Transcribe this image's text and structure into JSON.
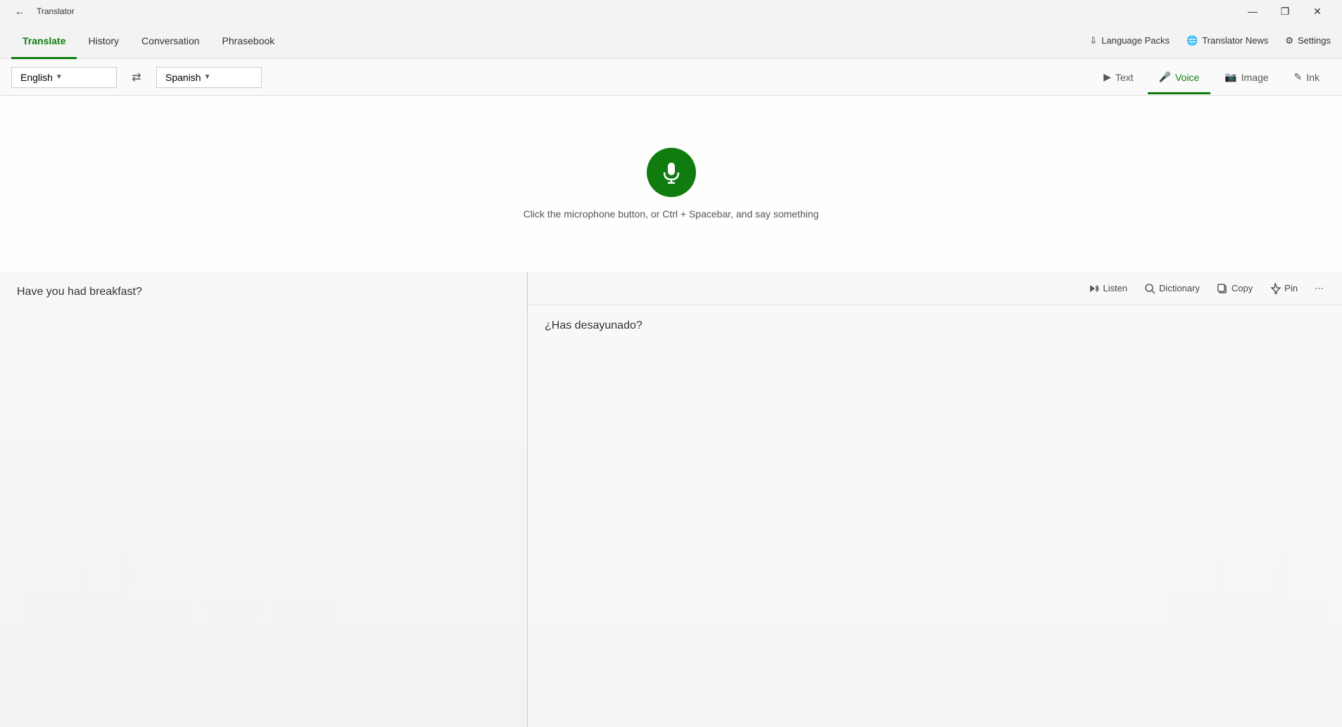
{
  "titleBar": {
    "title": "Translator",
    "backBtn": "←",
    "minimizeBtn": "—",
    "restoreBtn": "❐",
    "closeBtn": "✕"
  },
  "nav": {
    "items": [
      {
        "label": "Translate",
        "active": true
      },
      {
        "label": "History",
        "active": false
      },
      {
        "label": "Conversation",
        "active": false
      },
      {
        "label": "Phrasebook",
        "active": false
      }
    ],
    "rightItems": [
      {
        "label": "Language Packs",
        "icon": "download-icon"
      },
      {
        "label": "Translator News",
        "icon": "globe-icon"
      },
      {
        "label": "Settings",
        "icon": "settings-icon"
      }
    ]
  },
  "langBar": {
    "sourceLang": "English",
    "targetLang": "Spanish",
    "swapIcon": "⇄",
    "modes": [
      {
        "label": "Text",
        "icon": "text-icon",
        "active": false
      },
      {
        "label": "Voice",
        "icon": "voice-icon",
        "active": true
      },
      {
        "label": "Image",
        "icon": "image-icon",
        "active": false
      },
      {
        "label": "Ink",
        "icon": "ink-icon",
        "active": false
      }
    ]
  },
  "voicePanel": {
    "micHint": "Click the microphone button, or Ctrl + Spacebar, and say something"
  },
  "toolbar": {
    "listenLabel": "Listen",
    "dictionaryLabel": "Dictionary",
    "copyLabel": "Copy",
    "pinLabel": "Pin",
    "moreLabel": "⋯"
  },
  "leftPanel": {
    "text": "Have you had breakfast?"
  },
  "rightPanel": {
    "text": "¿Has desayunado?"
  }
}
